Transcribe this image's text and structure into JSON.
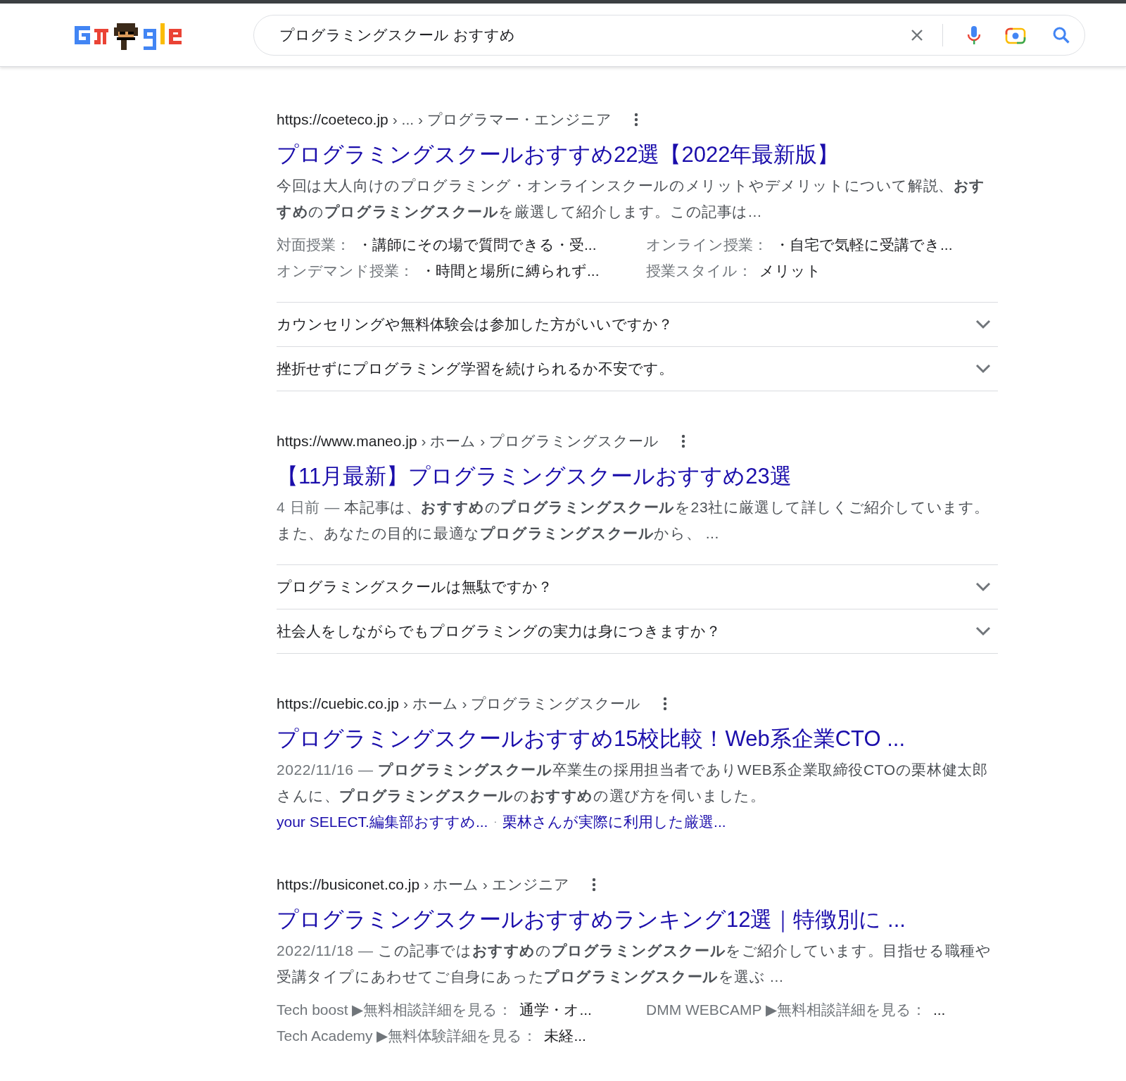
{
  "search": {
    "value": "プログラミングスクール おすすめ"
  },
  "results": [
    {
      "url": "https://coeteco.jp",
      "breadcrumb": "› ... › プログラマー・エンジニア",
      "title": "プログラミングスクールおすすめ22選【2022年最新版】",
      "snippet": "今回は大人向けのプログラミング・オンラインスクールのメリットやデメリットについて解説、**おすすめ**の**プログラミングスクール**を厳選して紹介します。この記事は...",
      "attributes": [
        {
          "label": "対面授業：",
          "value": "・講師にその場で質問できる・受..."
        },
        {
          "label": "オンライン授業：",
          "value": "・自宅で気軽に受講でき..."
        },
        {
          "label": "オンデマンド授業：",
          "value": "・時間と場所に縛られず..."
        },
        {
          "label": "授業スタイル：",
          "value": "メリット"
        }
      ],
      "questions": [
        {
          "text": "カウンセリングや無料体験会は参加した方がいいですか？",
          "expanded": false
        },
        {
          "text": "挫折せずにプログラミング学習を続けられるか不安です。",
          "expanded": false
        }
      ]
    },
    {
      "url": "https://www.maneo.jp",
      "breadcrumb": "› ホーム › プログラミングスクール",
      "title": "【11月最新】プログラミングスクールおすすめ23選",
      "date": "4 日前 — ",
      "snippet": "本記事は、**おすすめ**の**プログラミングスクール**を23社に厳選して詳しくご紹介しています。また、あなたの目的に最適な**プログラミングスクール**から、 ...",
      "questions": [
        {
          "text": "プログラミングスクールは無駄ですか？",
          "expanded": false
        },
        {
          "text": "社会人をしながらでもプログラミングの実力は身につきますか？",
          "expanded": false
        }
      ]
    },
    {
      "url": "https://cuebic.co.jp",
      "breadcrumb": "› ホーム › プログラミングスクール",
      "title": "プログラミングスクールおすすめ15校比較！Web系企業CTO ...",
      "date": "2022/11/16 — ",
      "snippet": "**プログラミングスクール**卒業生の採用担当者でありWEB系企業取締役CTOの栗林健太郎さんに、**プログラミングスクール**の**おすすめ**の選び方を伺いました。",
      "links": [
        "your SELECT.編集部おすすめ...",
        "栗林さんが実際に利用した厳選..."
      ],
      "link_separator": "·"
    },
    {
      "url": "https://busiconet.co.jp",
      "breadcrumb": "› ホーム › エンジニア",
      "title": "プログラミングスクールおすすめランキング12選｜特徴別に ...",
      "date": "2022/11/18 — ",
      "snippet": "この記事では**おすすめ**の**プログラミングスクール**をご紹介しています。目指せる職種や受講タイプにあわせてご自身にあった**プログラミングスクール**を選ぶ ...",
      "attributes": [
        {
          "label": "Tech boost ▶無料相談詳細を見る：",
          "value": "通学・オ..."
        },
        {
          "label": "DMM WEBCAMP ▶無料相談詳細を見る：",
          "value": "..."
        },
        {
          "label": "Tech Academy ▶無料体験詳細を見る：",
          "value": "未経..."
        }
      ]
    }
  ]
}
